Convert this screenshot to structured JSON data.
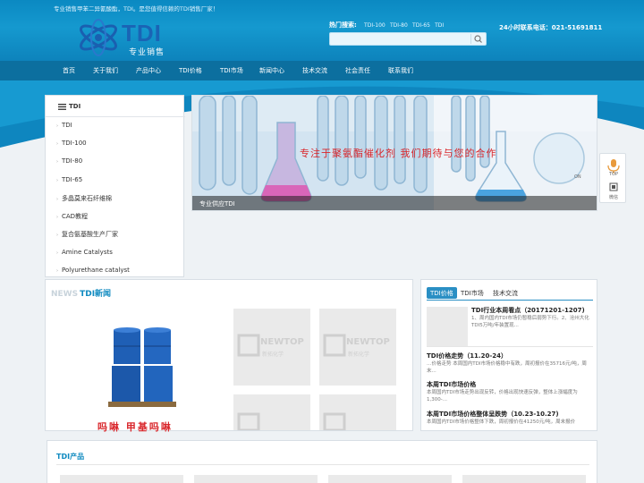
{
  "header": {
    "tagline": "专业销售甲苯二异氰酸酯，TDI。是您值得信赖的TDI销售厂家！",
    "logo_text": "TDI",
    "logo_sub": "专业销售",
    "hot_label": "热门搜索:",
    "hot_terms": [
      "TDI-100",
      "TDI-80",
      "TDI-65",
      "TDI"
    ],
    "search_placeholder": "",
    "phone": "24小时联系电话：021-51691811"
  },
  "nav": [
    "首页",
    "关于我们",
    "产品中心",
    "TDI价格",
    "TDI市场",
    "新闻中心",
    "技术交流",
    "社会责任",
    "联系我们"
  ],
  "sidebar": {
    "title": "TDI",
    "items": [
      "TDI",
      "TDI-100",
      "TDI-80",
      "TDI-65",
      "多晶莫来石纤维棉",
      "CAD教程",
      "复合氨基酸生产厂家",
      "Amine Catalysts",
      "Polyurethane catalyst"
    ]
  },
  "banner": {
    "slogan": "专注于聚氨酯催化剂   我们期待与您的合作",
    "caption": "专业供应TDI",
    "on_text": "ON"
  },
  "floatbar": {
    "top_label": "TOP",
    "wechat_label": "微信"
  },
  "news": {
    "title_en": "NEWS",
    "title_cn": "TDI新闻",
    "drum_text": "吗啉 甲基吗啉",
    "thumb_brand": "NEWTOP",
    "thumb_brand_cn": "新拓化学"
  },
  "tabs": {
    "labels": [
      "TDI价格",
      "TDI市场",
      "技术交流"
    ],
    "posts": [
      {
        "title": "TDI行业本周看点（20171201-1207)",
        "desc": "1、周内国内TDI市场仍暂稳后弱势下行。2、沧州大化TDI5万吨/年装置现..."
      },
      {
        "title": "TDI价格走势（11.20-24）",
        "desc": "…价格走势 本周国内TDI市场价格稳中有跌，周初报价在35716元/吨，周末..."
      },
      {
        "title": "本周TDI市场价格",
        "desc": "本周国内TDI市场走势出现反转，价格出现快速反弹，整体上涨幅度为1,300-..."
      },
      {
        "title": "本周TDI市场价格整体呈跌势（10.23-10.27)",
        "desc": "本周国内TDI市场价格整体下跌，周初报价在41250元/吨，周末报价"
      }
    ]
  },
  "products": {
    "title": "TDI产品"
  },
  "colors": {
    "header": "#0b89c2",
    "nav": "#0c6f9f",
    "accent": "#0f8ac0",
    "slogan": "#d9252a"
  }
}
